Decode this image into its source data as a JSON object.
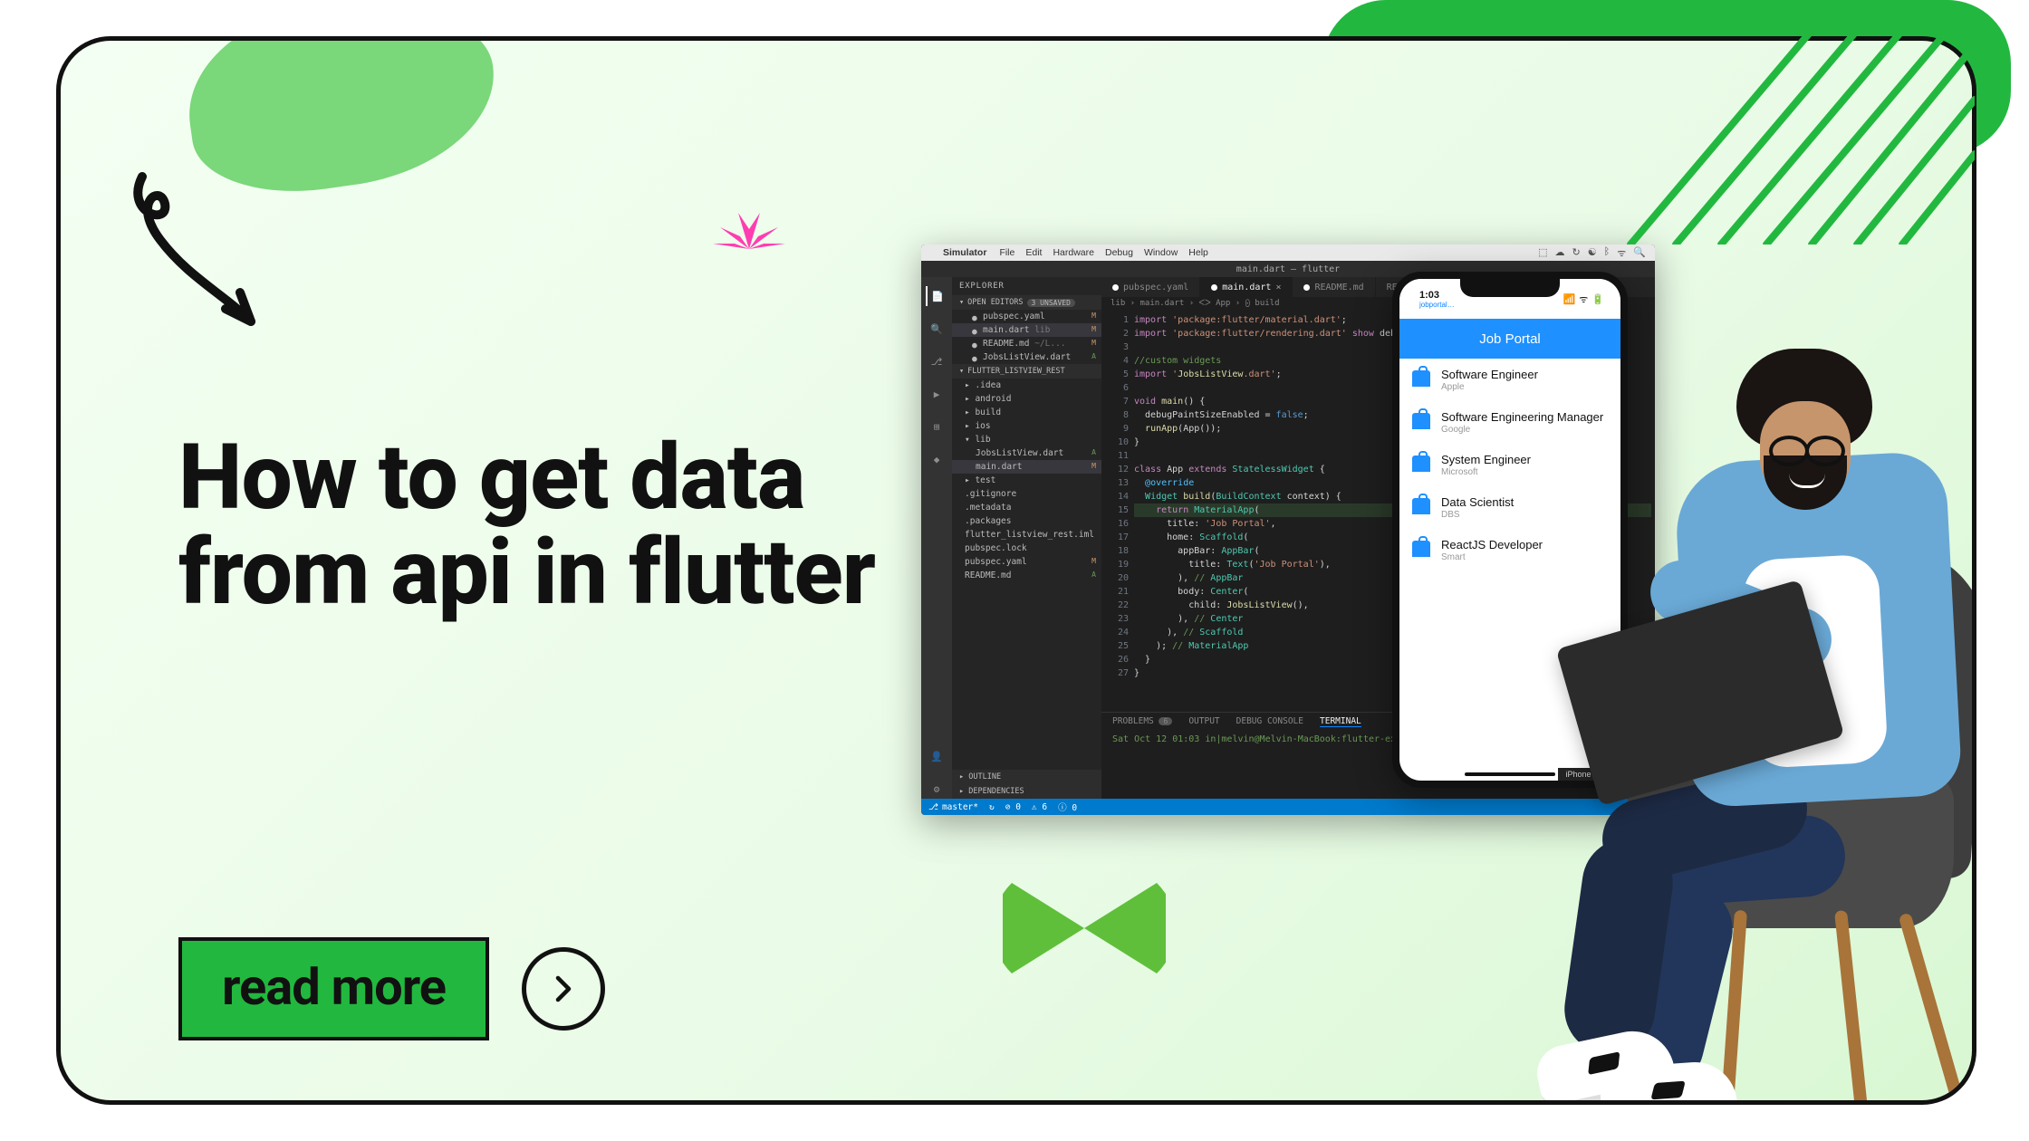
{
  "hero": {
    "title": "How to get data from api in flutter"
  },
  "cta": {
    "label": "read more"
  },
  "mac_menubar": {
    "app": "Simulator",
    "items": [
      "File",
      "Edit",
      "Hardware",
      "Debug",
      "Window",
      "Help"
    ]
  },
  "vscode": {
    "titlebar": "main.dart — flutter",
    "explorer_label": "EXPLORER",
    "open_editors_label": "OPEN EDITORS",
    "open_editors_badge": "3 UNSAVED",
    "open_editors": [
      {
        "name": "pubspec.yaml",
        "status": "M"
      },
      {
        "name": "main.dart",
        "path": "lib",
        "status": "M",
        "active": true
      },
      {
        "name": "README.md",
        "path": "~/L...",
        "status": "M"
      },
      {
        "name": "JobsListView.dart",
        "status": "A"
      }
    ],
    "project_label": "FLUTTER_LISTVIEW_REST",
    "tree": [
      {
        "name": ".idea",
        "kind": "folder"
      },
      {
        "name": "android",
        "kind": "folder"
      },
      {
        "name": "build",
        "kind": "folder"
      },
      {
        "name": "ios",
        "kind": "folder"
      },
      {
        "name": "lib",
        "kind": "folder",
        "open": true,
        "status": "●"
      },
      {
        "name": "JobsListView.dart",
        "kind": "file",
        "indent": 1,
        "status": "A"
      },
      {
        "name": "main.dart",
        "kind": "file",
        "indent": 1,
        "status": "M",
        "active": true
      },
      {
        "name": "test",
        "kind": "folder"
      },
      {
        "name": ".gitignore",
        "kind": "file"
      },
      {
        "name": ".metadata",
        "kind": "file"
      },
      {
        "name": ".packages",
        "kind": "file"
      },
      {
        "name": "flutter_listview_rest.iml",
        "kind": "file"
      },
      {
        "name": "pubspec.lock",
        "kind": "file"
      },
      {
        "name": "pubspec.yaml",
        "kind": "file",
        "status": "M"
      },
      {
        "name": "README.md",
        "kind": "file",
        "status": "A"
      }
    ],
    "outline_label": "OUTLINE",
    "dependencies_label": "DEPENDENCIES",
    "tabs": [
      {
        "label": "pubspec.yaml",
        "dirty": true
      },
      {
        "label": "main.dart",
        "dirty": true,
        "active": true,
        "closeable": true
      },
      {
        "label": "README.md",
        "dirty": true
      },
      {
        "label": "README.md ~/...flutter"
      }
    ],
    "breadcrumb": "lib › main.dart › ᐸᐳ App › ⨀ build",
    "code_lines": [
      "import 'package:flutter/material.dart';",
      "import 'package:flutter/rendering.dart' show debugPaintSizeEnabled;",
      "",
      "//custom widgets",
      "import 'JobsListView.dart';",
      "",
      "void main() {",
      "  debugPaintSizeEnabled = false;",
      "  runApp(App());",
      "}",
      "",
      "class App extends StatelessWidget {",
      "  @override",
      "  Widget build(BuildContext context) {",
      "    return MaterialApp(",
      "      title: 'Job Portal',",
      "      home: Scaffold(",
      "        appBar: AppBar(",
      "          title: Text('Job Portal'),",
      "        ), // AppBar",
      "        body: Center(",
      "          child: JobsListView(),",
      "        ), // Center",
      "      ), // Scaffold",
      "    ); // MaterialApp",
      "  }",
      "}"
    ],
    "highlight_line_index": 14,
    "terminal": {
      "tabs": [
        "PROBLEMS",
        "OUTPUT",
        "DEBUG CONSOLE",
        "TERMINAL"
      ],
      "active_tab": "TERMINAL",
      "problems_badge": "6",
      "prompt": "Sat Oct 12 01:03 in|melvin@Melvin-MacBook:flutter-examples|$ "
    },
    "statusbar": {
      "branch": "master*",
      "sync": "↻",
      "errors": "0",
      "warnings": "6",
      "info": "0"
    }
  },
  "phone": {
    "time": "1:03",
    "carrier_sub": "jobportal…",
    "appbar_title": "Job Portal",
    "device_label": "iPhone Xs —",
    "jobs": [
      {
        "title": "Software Engineer",
        "company": "Apple"
      },
      {
        "title": "Software Engineering Manager",
        "company": "Google"
      },
      {
        "title": "System Engineer",
        "company": "Microsoft"
      },
      {
        "title": "Data Scientist",
        "company": "DBS"
      },
      {
        "title": "ReactJS Developer",
        "company": "Smart"
      }
    ]
  }
}
